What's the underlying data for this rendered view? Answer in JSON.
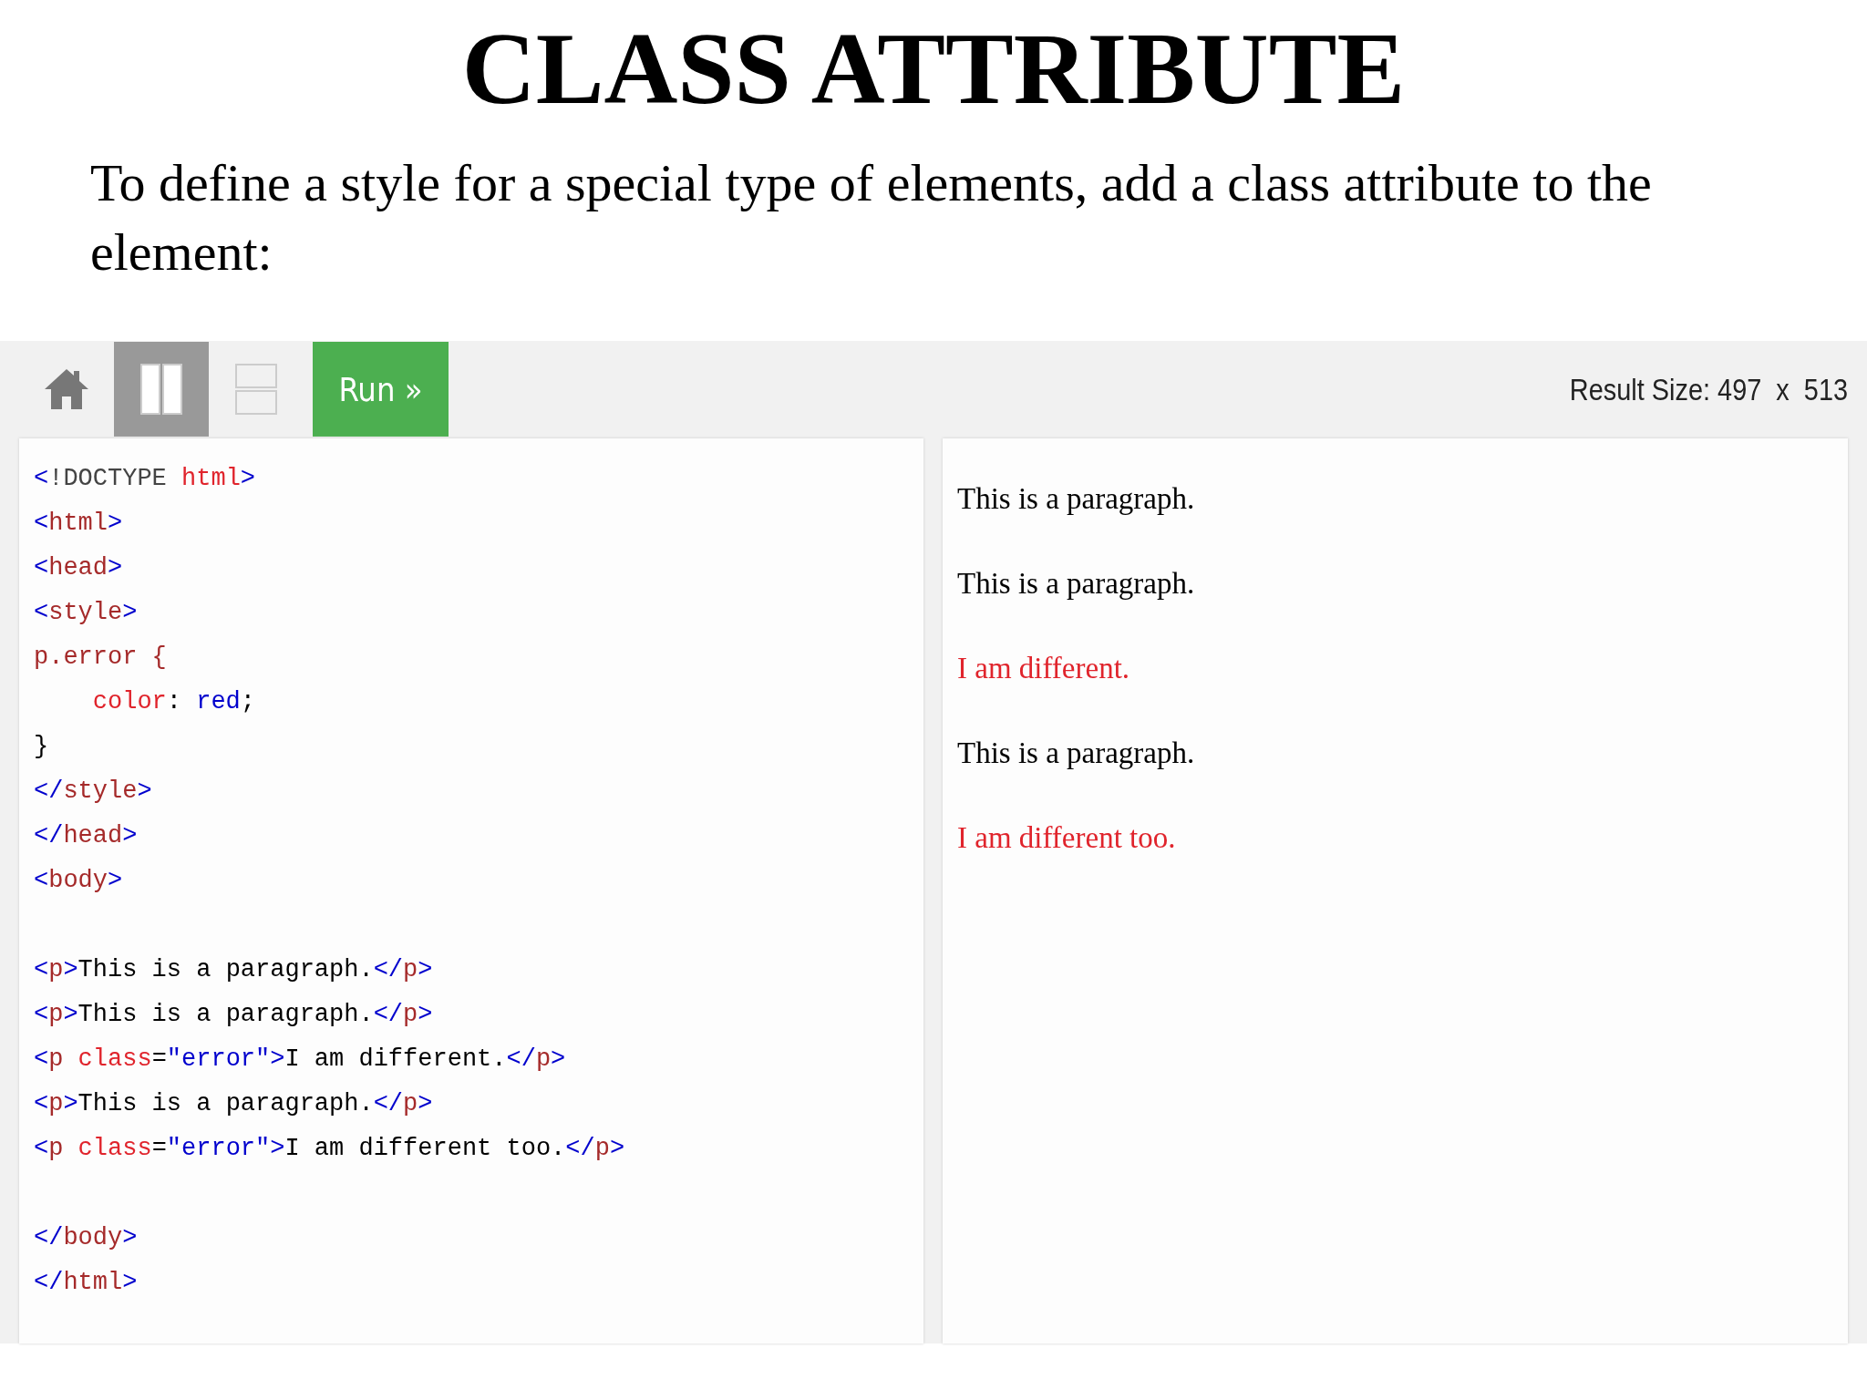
{
  "title": "CLASS ATTRIBUTE",
  "description": "To define a style for a special type of elements, add a class attribute to the element:",
  "toolbar": {
    "buttons": [
      {
        "kind": "home",
        "selected": false
      },
      {
        "kind": "columns",
        "selected": true
      },
      {
        "kind": "rows",
        "selected": false
      }
    ],
    "run_button": "Run »",
    "result_size": "Result Size: 497  x  513"
  },
  "code_lines": [
    {
      "indented": false,
      "gap_before": false,
      "tokens": [
        {
          "text": "<",
          "kind": "bracket"
        },
        {
          "text": "!DOCTYPE ",
          "kind": "keyword"
        },
        {
          "text": "html",
          "kind": "attr"
        },
        {
          "text": ">",
          "kind": "bracket"
        }
      ]
    },
    {
      "indented": false,
      "gap_before": false,
      "tokens": [
        {
          "text": "<",
          "kind": "bracket"
        },
        {
          "text": "html",
          "kind": "tag"
        },
        {
          "text": ">",
          "kind": "bracket"
        }
      ]
    },
    {
      "indented": false,
      "gap_before": false,
      "tokens": [
        {
          "text": "<",
          "kind": "bracket"
        },
        {
          "text": "head",
          "kind": "tag"
        },
        {
          "text": ">",
          "kind": "bracket"
        }
      ]
    },
    {
      "indented": false,
      "gap_before": false,
      "tokens": [
        {
          "text": "<",
          "kind": "bracket"
        },
        {
          "text": "style",
          "kind": "tag"
        },
        {
          "text": ">",
          "kind": "bracket"
        }
      ]
    },
    {
      "indented": false,
      "gap_before": false,
      "tokens": [
        {
          "text": "p.error {",
          "kind": "tag"
        }
      ]
    },
    {
      "indented": true,
      "gap_before": false,
      "tokens": [
        {
          "text": "color",
          "kind": "attr"
        },
        {
          "text": ": ",
          "kind": "text"
        },
        {
          "text": "red",
          "kind": "value"
        },
        {
          "text": ";",
          "kind": "text"
        }
      ]
    },
    {
      "indented": false,
      "gap_before": false,
      "tokens": [
        {
          "text": "}",
          "kind": "text"
        }
      ]
    },
    {
      "indented": false,
      "gap_before": false,
      "tokens": [
        {
          "text": "</",
          "kind": "bracket"
        },
        {
          "text": "style",
          "kind": "tag"
        },
        {
          "text": ">",
          "kind": "bracket"
        }
      ]
    },
    {
      "indented": false,
      "gap_before": false,
      "tokens": [
        {
          "text": "</",
          "kind": "bracket"
        },
        {
          "text": "head",
          "kind": "tag"
        },
        {
          "text": ">",
          "kind": "bracket"
        }
      ]
    },
    {
      "indented": false,
      "gap_before": false,
      "tokens": [
        {
          "text": "<",
          "kind": "bracket"
        },
        {
          "text": "body",
          "kind": "tag"
        },
        {
          "text": ">",
          "kind": "bracket"
        }
      ]
    },
    {
      "indented": false,
      "gap_before": true,
      "tokens": [
        {
          "text": "<",
          "kind": "bracket"
        },
        {
          "text": "p",
          "kind": "tag"
        },
        {
          "text": ">",
          "kind": "bracket"
        },
        {
          "text": "This is a paragraph.",
          "kind": "text"
        },
        {
          "text": "</",
          "kind": "bracket"
        },
        {
          "text": "p",
          "kind": "tag"
        },
        {
          "text": ">",
          "kind": "bracket"
        }
      ]
    },
    {
      "indented": false,
      "gap_before": false,
      "tokens": [
        {
          "text": "<",
          "kind": "bracket"
        },
        {
          "text": "p",
          "kind": "tag"
        },
        {
          "text": ">",
          "kind": "bracket"
        },
        {
          "text": "This is a paragraph.",
          "kind": "text"
        },
        {
          "text": "</",
          "kind": "bracket"
        },
        {
          "text": "p",
          "kind": "tag"
        },
        {
          "text": ">",
          "kind": "bracket"
        }
      ]
    },
    {
      "indented": false,
      "gap_before": false,
      "tokens": [
        {
          "text": "<",
          "kind": "bracket"
        },
        {
          "text": "p ",
          "kind": "tag"
        },
        {
          "text": "class",
          "kind": "attr"
        },
        {
          "text": "=",
          "kind": "text"
        },
        {
          "text": "\"error\"",
          "kind": "value"
        },
        {
          "text": ">",
          "kind": "bracket"
        },
        {
          "text": "I am different.",
          "kind": "text"
        },
        {
          "text": "</",
          "kind": "bracket"
        },
        {
          "text": "p",
          "kind": "tag"
        },
        {
          "text": ">",
          "kind": "bracket"
        }
      ]
    },
    {
      "indented": false,
      "gap_before": false,
      "tokens": [
        {
          "text": "<",
          "kind": "bracket"
        },
        {
          "text": "p",
          "kind": "tag"
        },
        {
          "text": ">",
          "kind": "bracket"
        },
        {
          "text": "This is a paragraph.",
          "kind": "text"
        },
        {
          "text": "</",
          "kind": "bracket"
        },
        {
          "text": "p",
          "kind": "tag"
        },
        {
          "text": ">",
          "kind": "bracket"
        }
      ]
    },
    {
      "indented": false,
      "gap_before": false,
      "tokens": [
        {
          "text": "<",
          "kind": "bracket"
        },
        {
          "text": "p ",
          "kind": "tag"
        },
        {
          "text": "class",
          "kind": "attr"
        },
        {
          "text": "=",
          "kind": "text"
        },
        {
          "text": "\"error\"",
          "kind": "value"
        },
        {
          "text": ">",
          "kind": "bracket"
        },
        {
          "text": "I am different too.",
          "kind": "text"
        },
        {
          "text": "</",
          "kind": "bracket"
        },
        {
          "text": "p",
          "kind": "tag"
        },
        {
          "text": ">",
          "kind": "bracket"
        }
      ]
    },
    {
      "indented": false,
      "gap_before": true,
      "tokens": [
        {
          "text": "</",
          "kind": "bracket"
        },
        {
          "text": "body",
          "kind": "tag"
        },
        {
          "text": ">",
          "kind": "bracket"
        }
      ]
    },
    {
      "indented": false,
      "gap_before": false,
      "tokens": [
        {
          "text": "</",
          "kind": "bracket"
        },
        {
          "text": "html",
          "kind": "tag"
        },
        {
          "text": ">",
          "kind": "bracket"
        }
      ]
    }
  ],
  "result": [
    {
      "text": "This is a paragraph.",
      "error": false
    },
    {
      "text": "This is a paragraph.",
      "error": false
    },
    {
      "text": "I am different.",
      "error": true
    },
    {
      "text": "This is a paragraph.",
      "error": false
    },
    {
      "text": "I am different too.",
      "error": true
    }
  ]
}
